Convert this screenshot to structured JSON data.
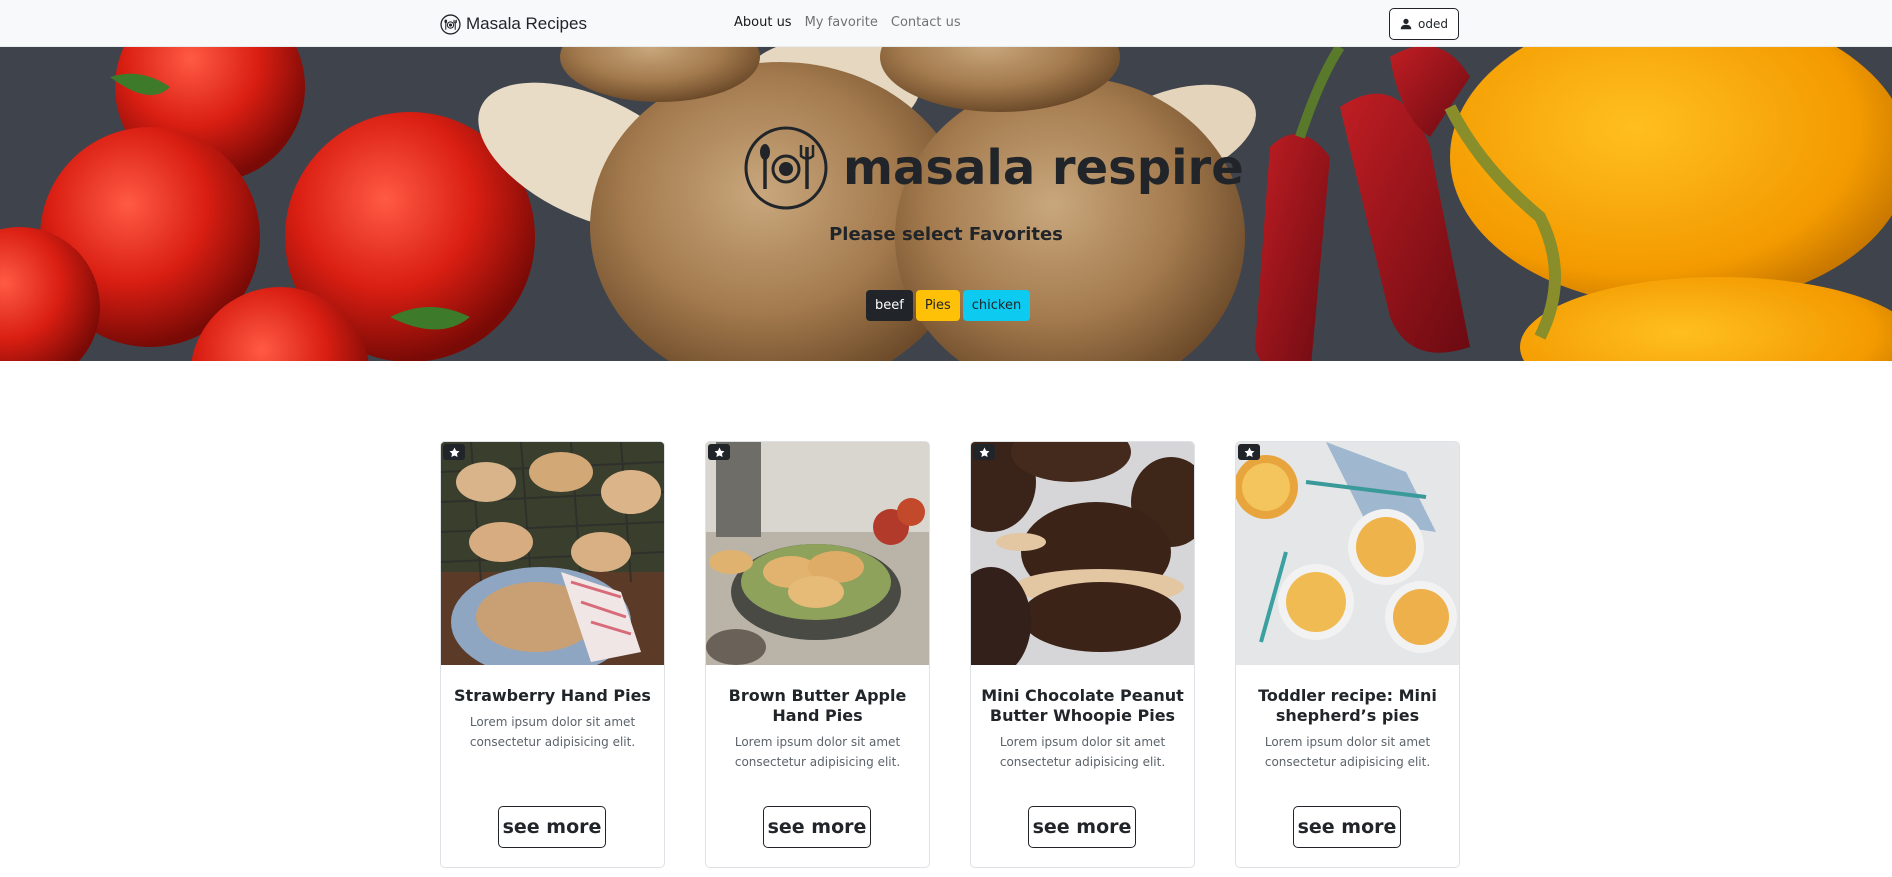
{
  "navbar": {
    "brand": "Masala Recipes",
    "links": [
      {
        "label": "About us"
      },
      {
        "label": "My favorite"
      },
      {
        "label": "Contact us"
      }
    ],
    "user": "oded"
  },
  "hero": {
    "title": "masala respire",
    "subtitle": "Please select Favorites",
    "tags": [
      "beef",
      "Pies",
      "chicken"
    ]
  },
  "cards": [
    {
      "title": "Strawberry Hand Pies",
      "text": "Lorem ipsum dolor sit amet consectetur adipisicing elit.",
      "button": "see more"
    },
    {
      "title": "Brown Butter Apple Hand Pies",
      "text": "Lorem ipsum dolor sit amet consectetur adipisicing elit.",
      "button": "see more"
    },
    {
      "title": "Mini Chocolate Peanut Butter Whoopie Pies",
      "text": "Lorem ipsum dolor sit amet consectetur adipisicing elit.",
      "button": "see more"
    },
    {
      "title": "Toddler recipe: Mini shepherd’s pies",
      "text": "Lorem ipsum dolor sit amet consectetur adipisicing elit.",
      "button": "see more"
    }
  ],
  "icons": {
    "brand": "plate-fork-spoon-icon",
    "user": "person-icon",
    "favorite": "star-icon"
  },
  "colors": {
    "tag_beef": "#212529",
    "tag_pies": "#ffc107",
    "tag_chicken": "#0dcaf0"
  }
}
